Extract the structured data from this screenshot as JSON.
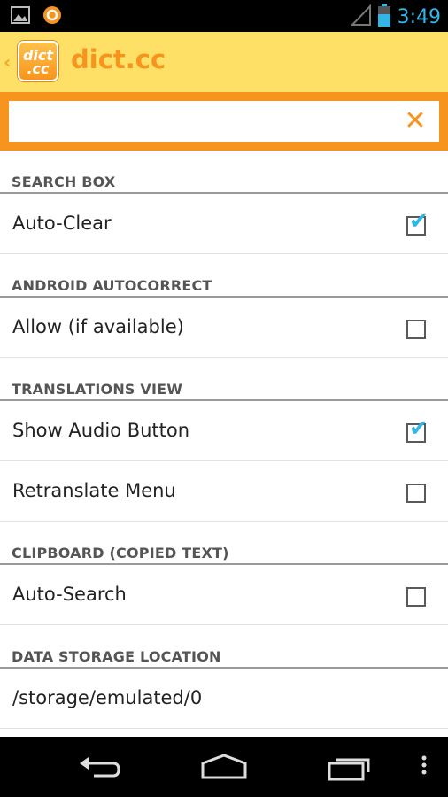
{
  "status_bar": {
    "time": "3:49",
    "colors": {
      "clock": "#33b5e5"
    },
    "icons": [
      "image-notification-icon",
      "avast-notification-icon",
      "signal-icon",
      "battery-icon"
    ]
  },
  "action_bar": {
    "logo_line1": "dict",
    "logo_line2": ".cc",
    "title": "dict.cc",
    "colors": {
      "background": "#ffe066",
      "accent": "#f7941d"
    }
  },
  "search": {
    "value": "",
    "placeholder": "",
    "clear_glyph": "✕"
  },
  "sections": {
    "search_box": {
      "header": "SEARCH BOX",
      "auto_clear": {
        "label": "Auto-Clear",
        "checked": true
      }
    },
    "android_autocorrect": {
      "header": "ANDROID AUTOCORRECT",
      "allow": {
        "label": "Allow (if available)",
        "checked": false
      }
    },
    "translations_view": {
      "header": "TRANSLATIONS VIEW",
      "show_audio": {
        "label": "Show Audio Button",
        "checked": true
      },
      "retranslate_menu": {
        "label": "Retranslate Menu",
        "checked": false
      }
    },
    "clipboard": {
      "header": "CLIPBOARD (COPIED TEXT)",
      "auto_search": {
        "label": "Auto-Search",
        "checked": false
      }
    },
    "data_storage": {
      "header": "DATA STORAGE LOCATION",
      "path": {
        "label": "/storage/emulated/0"
      }
    }
  },
  "nav_bar": {
    "icons": [
      "back-icon",
      "home-icon",
      "recent-apps-icon",
      "overflow-menu-icon"
    ]
  }
}
